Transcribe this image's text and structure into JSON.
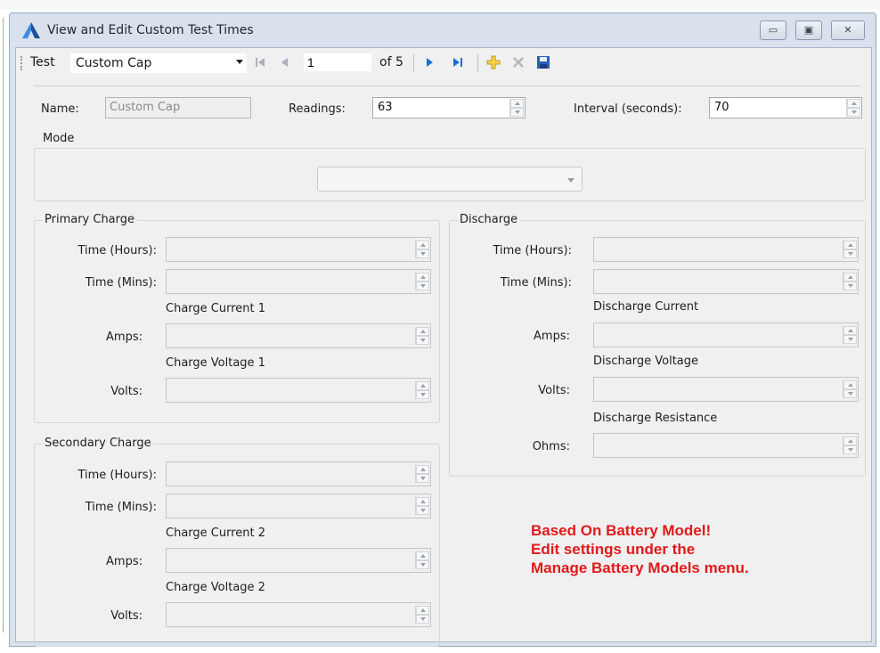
{
  "window": {
    "title": "View and Edit Custom Test Times",
    "buttons": {
      "minimize": "▭",
      "restore": "▣",
      "close": "✕"
    }
  },
  "toolbar": {
    "test_label": "Test",
    "test_value": "Custom Cap",
    "position": "1",
    "of_total": "of 5"
  },
  "header": {
    "name_label": "Name:",
    "name_value": "Custom Cap",
    "readings_label": "Readings:",
    "readings_value": "63",
    "interval_label": "Interval (seconds):",
    "interval_value": "70"
  },
  "mode": {
    "label": "Mode",
    "value": ""
  },
  "primary": {
    "title": "Primary Charge",
    "hours_label": "Time (Hours):",
    "mins_label": "Time (Mins):",
    "current_caption": "Charge Current 1",
    "amps_label": "Amps:",
    "voltage_caption": "Charge Voltage 1",
    "volts_label": "Volts:"
  },
  "secondary": {
    "title": "Secondary Charge",
    "hours_label": "Time (Hours):",
    "mins_label": "Time (Mins):",
    "current_caption": "Charge Current 2",
    "amps_label": "Amps:",
    "voltage_caption": "Charge Voltage 2",
    "volts_label": "Volts:"
  },
  "discharge": {
    "title": "Discharge",
    "hours_label": "Time (Hours):",
    "mins_label": "Time (Mins):",
    "current_caption": "Discharge Current",
    "amps_label": "Amps:",
    "voltage_caption": "Discharge Voltage",
    "volts_label": "Volts:",
    "resistance_caption": "Discharge Resistance",
    "ohms_label": "Ohms:"
  },
  "notice": {
    "line1": "Based On Battery Model!",
    "line2": "Edit settings under the",
    "line3": "Manage Battery Models menu."
  },
  "colors": {
    "warning": "#e11a1a",
    "accent_icon": "#1f6fd1"
  }
}
